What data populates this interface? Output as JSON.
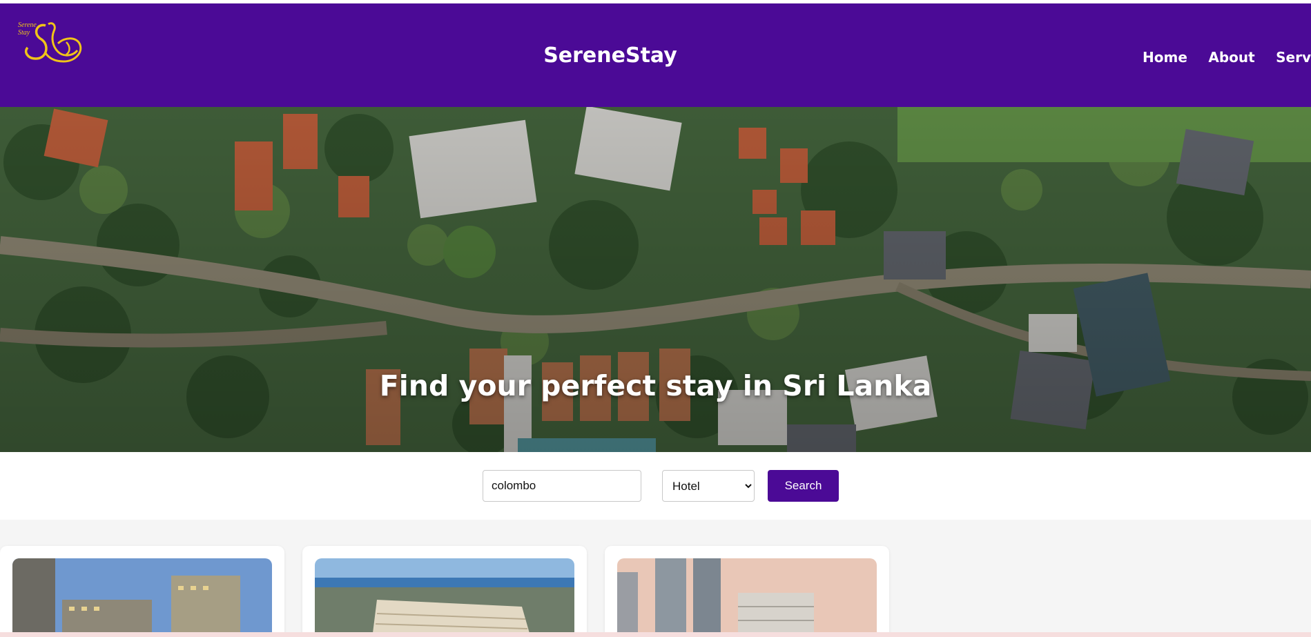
{
  "brand": {
    "logo_text_line1": "Serene",
    "logo_text_line2": "Stay",
    "title": "SereneStay",
    "primary_color": "#4b0a96",
    "logo_color": "#f0c419"
  },
  "nav": {
    "items": [
      "Home",
      "About",
      "Services"
    ]
  },
  "hero": {
    "heading": "Find your perfect stay in Sri Lanka"
  },
  "search": {
    "location_value": "colombo",
    "type_selected": "Hotel",
    "button_label": "Search"
  },
  "listings": {
    "cards": [
      {
        "image": "hotel-photo"
      },
      {
        "image": "hotel-photo"
      },
      {
        "image": "hotel-photo"
      }
    ]
  }
}
